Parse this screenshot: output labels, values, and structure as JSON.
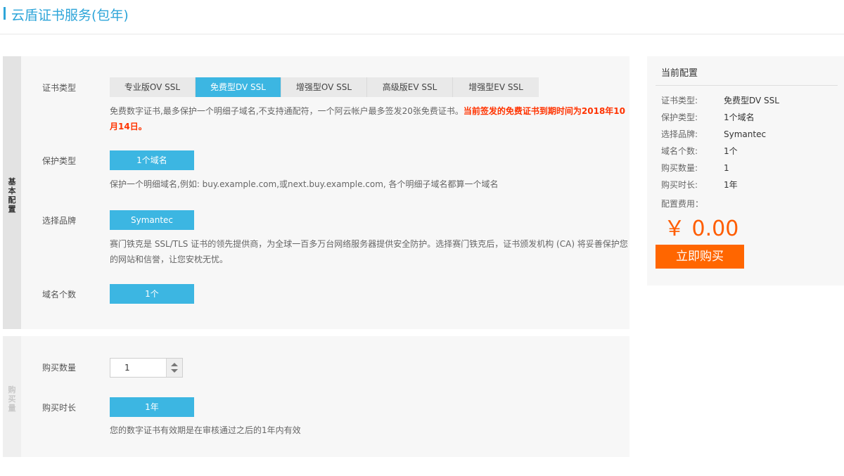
{
  "header": {
    "title": "云盾证书服务(包年)"
  },
  "basic": {
    "side_label": [
      "基",
      "本",
      "配",
      "置"
    ],
    "cert_type": {
      "label": "证书类型",
      "tabs": [
        {
          "label": "专业版OV SSL",
          "active": false
        },
        {
          "label": "免费型DV SSL",
          "active": true
        },
        {
          "label": "增强型OV SSL",
          "active": false
        },
        {
          "label": "高级版EV SSL",
          "active": false
        },
        {
          "label": "增强型EV SSL",
          "active": false
        }
      ],
      "desc": "免费数字证书,最多保护一个明细子域名,不支持通配符，一个阿云帐户最多签发20张免费证书。",
      "desc_notice": "当前签发的免费证书到期时间为2018年10月14日。"
    },
    "protect_type": {
      "label": "保护类型",
      "option": "1个域名",
      "desc": "保护一个明细域名,例如: buy.example.com,或next.buy.example.com, 各个明细子域名都算一个域名"
    },
    "brand": {
      "label": "选择品牌",
      "option": "Symantec",
      "desc": "赛门铁克是 SSL/TLS 证书的领先提供商，为全球一百多万台网络服务器提供安全防护。选择赛门铁克后，证书颁发机构 (CA) 将妥善保护您的网站和信誉，让您安枕无忧。"
    },
    "domain_count": {
      "label": "域名个数",
      "option": "1个"
    }
  },
  "purchase": {
    "side_label": [
      "购",
      "买",
      "量"
    ],
    "quantity": {
      "label": "购买数量",
      "value": "1"
    },
    "duration": {
      "label": "购买时长",
      "option": "1年",
      "desc": "您的数字证书有效期是在审核通过之后的1年内有效"
    }
  },
  "summary": {
    "title": "当前配置",
    "rows": [
      {
        "key": "证书类型:",
        "value": "免费型DV SSL"
      },
      {
        "key": "保护类型:",
        "value": "1个域名"
      },
      {
        "key": "选择品牌:",
        "value": "Symantec"
      },
      {
        "key": "域名个数:",
        "value": "1个"
      },
      {
        "key": "购买数量:",
        "value": "1"
      },
      {
        "key": "购买时长:",
        "value": "1年"
      }
    ],
    "fee_label": "配置费用：",
    "price": "￥ 0.00",
    "buy_button": "立即购买"
  },
  "colors": {
    "accent": "#3cb6e2",
    "title": "#2ea5d9",
    "price": "#ff5d00",
    "buy_button": "#ff6600",
    "notice": "#ff3300"
  }
}
